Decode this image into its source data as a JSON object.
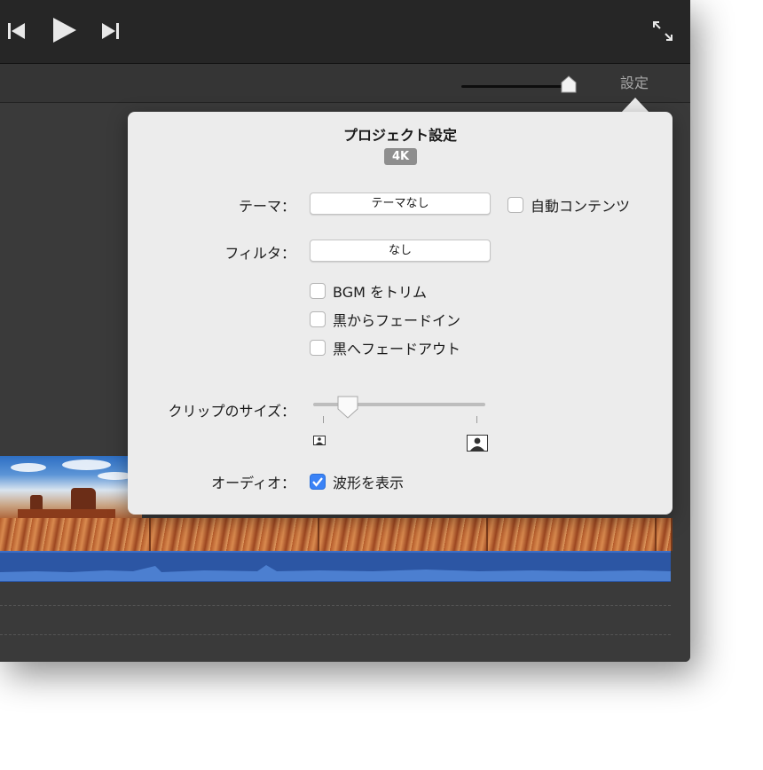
{
  "toolbar": {
    "prev_icon": "skip-back-icon",
    "play_icon": "play-icon",
    "next_icon": "skip-forward-icon",
    "fullscreen_icon": "expand-icon",
    "zoom_slider_value": 0.95,
    "settings_label": "設定"
  },
  "popover": {
    "title": "プロジェクト設定",
    "resolution_badge": "4K",
    "theme": {
      "label": "テーマ：",
      "value": "テーマなし"
    },
    "auto_content": {
      "label": "自動コンテンツ",
      "checked": false
    },
    "filter": {
      "label": "フィルタ：",
      "value": "なし"
    },
    "options": [
      {
        "label": "BGM をトリム",
        "checked": false
      },
      {
        "label": "黒からフェードイン",
        "checked": false
      },
      {
        "label": "黒へフェードアウト",
        "checked": false
      }
    ],
    "clip_size": {
      "label": "クリップのサイズ：",
      "value": 0.2,
      "small_icon": "small-thumbnail-icon",
      "large_icon": "large-thumbnail-icon"
    },
    "audio": {
      "label": "オーディオ：",
      "waveform_label": "波形を表示",
      "checked": true
    }
  },
  "colors": {
    "accent": "#3a82f6",
    "audio_track": "#2c56a4",
    "toolbar": "#262626",
    "popover_bg": "#ececec"
  }
}
